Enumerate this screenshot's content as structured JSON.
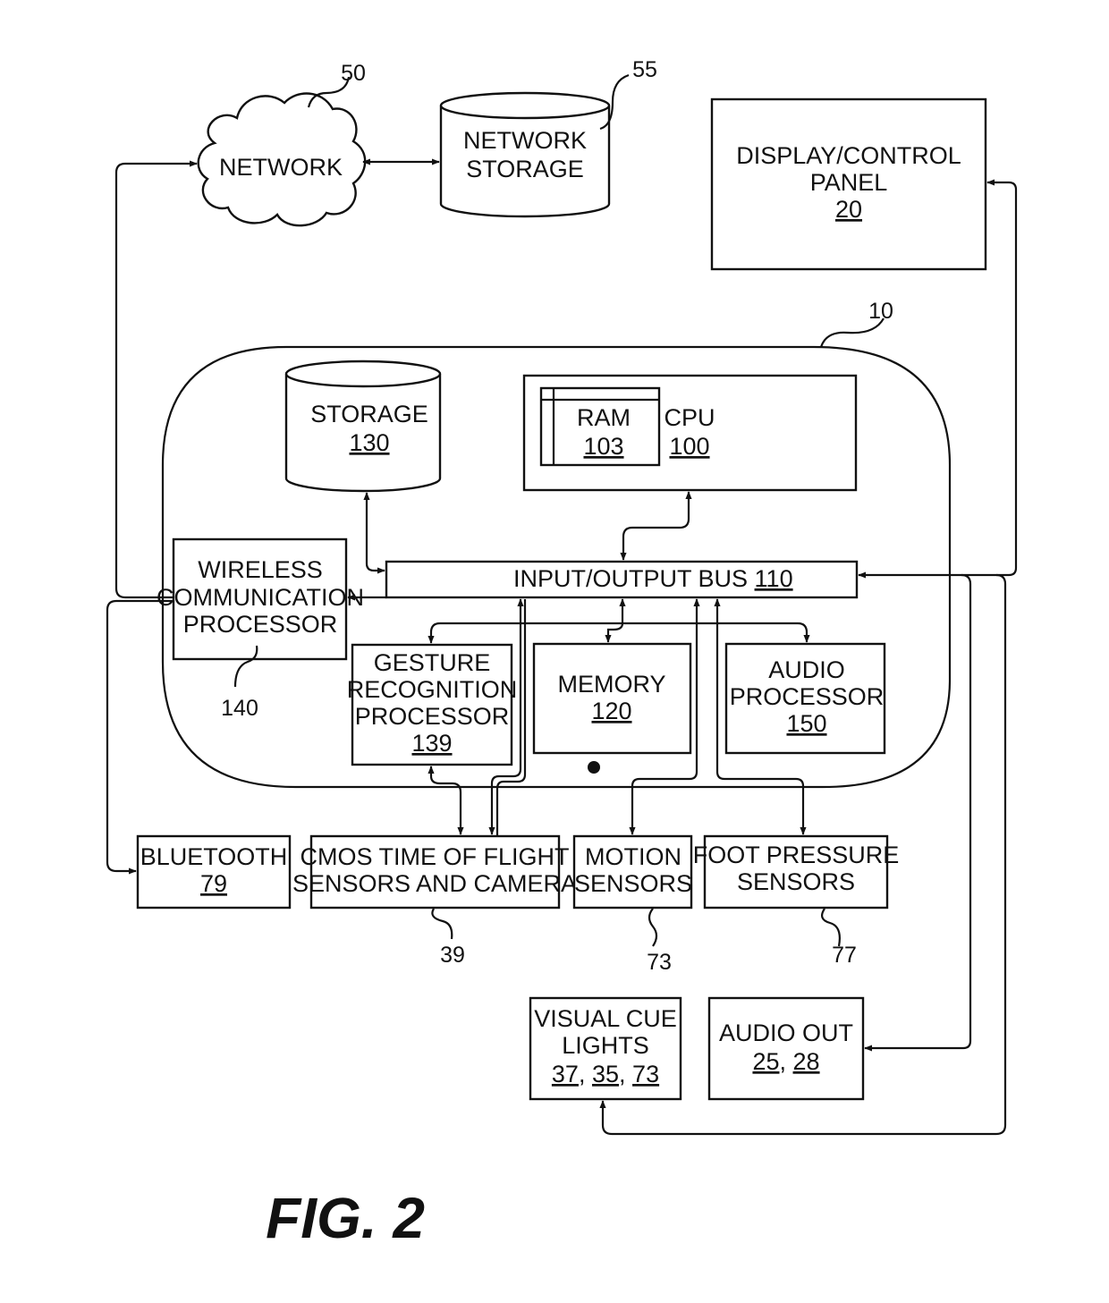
{
  "figure": {
    "caption": "FIG. 2"
  },
  "nodes": {
    "network": {
      "label": "NETWORK",
      "ref": "50"
    },
    "network_storage": {
      "line1": "NETWORK",
      "line2": "STORAGE",
      "ref": "55"
    },
    "display_panel": {
      "line1": "DISPLAY/CONTROL",
      "line2": "PANEL",
      "num": "20"
    },
    "device": {
      "ref": "10"
    },
    "storage": {
      "label": "STORAGE",
      "num": "130"
    },
    "cpu": {
      "label": "CPU",
      "num": "100"
    },
    "ram": {
      "label": "RAM",
      "num": "103"
    },
    "io_bus": {
      "label": "INPUT/OUTPUT BUS",
      "num": "110"
    },
    "wireless": {
      "line1": "WIRELESS",
      "line2": "COMMUNICATION",
      "line3": "PROCESSOR",
      "ref": "140"
    },
    "gesture": {
      "line1": "GESTURE",
      "line2": "RECOGNITION",
      "line3": "PROCESSOR",
      "num": "139"
    },
    "memory": {
      "label": "MEMORY",
      "num": "120"
    },
    "audio_processor": {
      "line1": "AUDIO",
      "line2": "PROCESSOR",
      "num": "150"
    },
    "bluetooth": {
      "label": "BLUETOOTH",
      "num": "79"
    },
    "cmos": {
      "line1": "CMOS TIME OF FLIGHT",
      "line2": "SENSORS AND CAMERA",
      "ref": "39"
    },
    "motion": {
      "line1": "MOTION",
      "line2": "SENSORS",
      "ref": "73"
    },
    "foot": {
      "line1": "FOOT PRESSURE",
      "line2": "SENSORS",
      "ref": "77"
    },
    "visual_cue": {
      "line1": "VISUAL CUE",
      "line2": "LIGHTS",
      "num1": "37",
      "num2": "35",
      "num3": "73",
      "sep": ","
    },
    "audio_out": {
      "label": "AUDIO OUT",
      "num1": "25",
      "num2": "28",
      "sep": ","
    }
  }
}
